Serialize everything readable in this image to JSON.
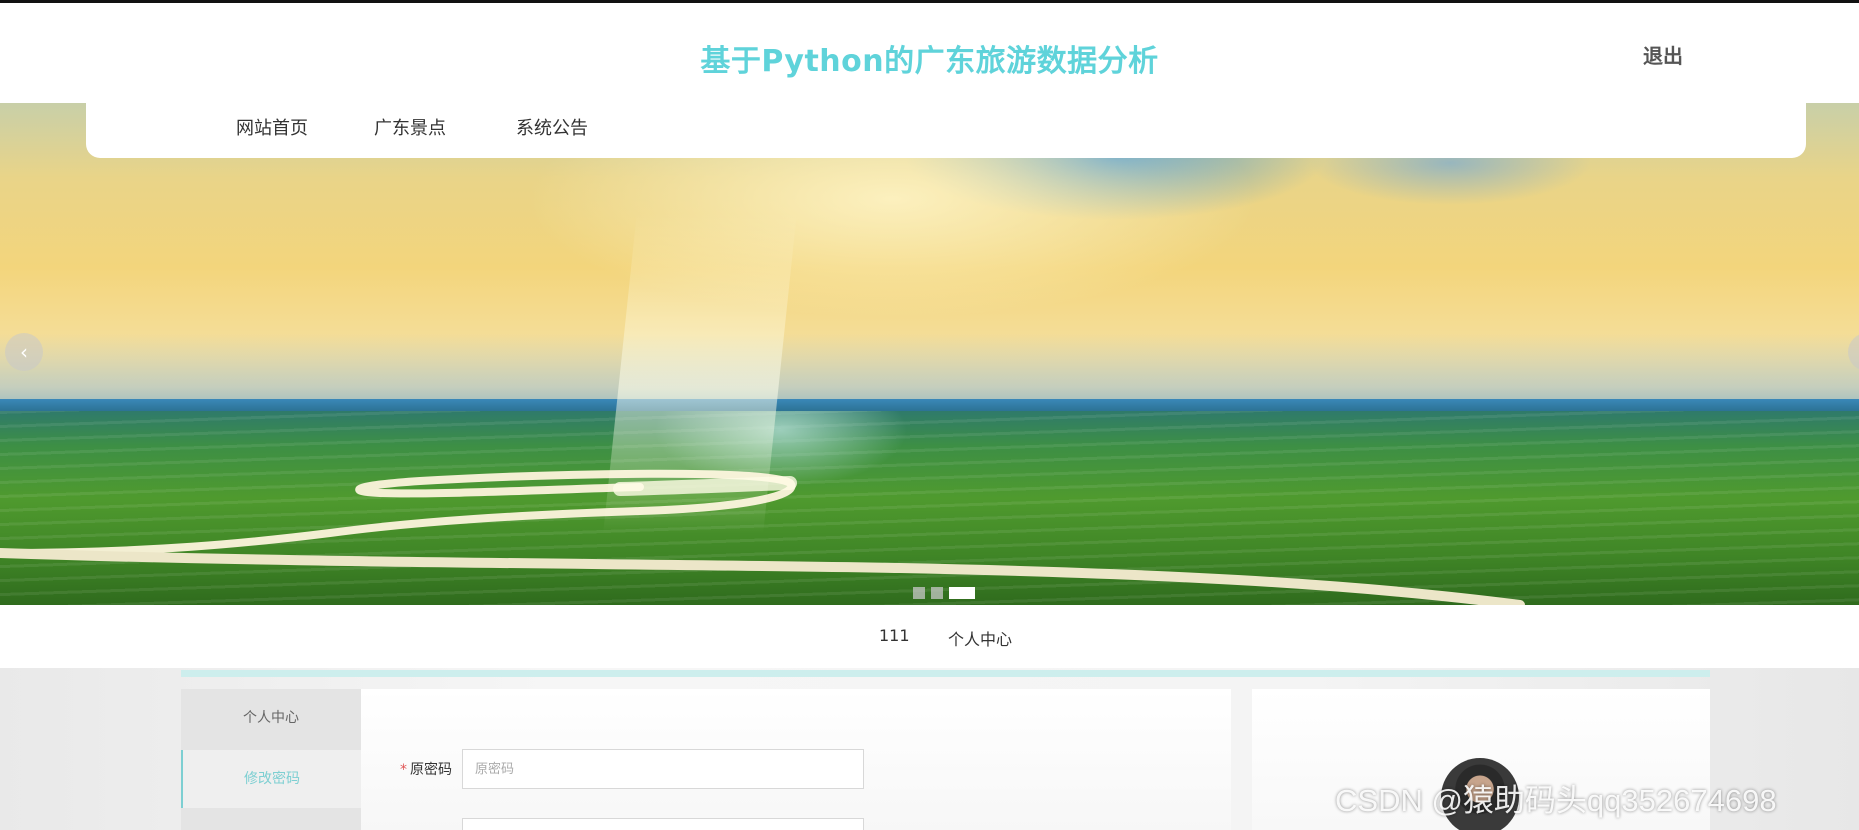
{
  "header": {
    "title": "基于Python的广东旅游数据分析",
    "logout_label": "退出"
  },
  "nav": {
    "items": [
      {
        "label": "网站首页"
      },
      {
        "label": "广东景点"
      },
      {
        "label": "系统公告"
      }
    ]
  },
  "carousel": {
    "prev_icon": "chevron-left-icon",
    "next_icon": "chevron-right-icon",
    "prev_glyph": "‹",
    "next_glyph": "›",
    "slide_count": 3,
    "active_index": 2
  },
  "breadcrumb": {
    "current_user": "111",
    "section": "个人中心"
  },
  "sidebar": {
    "items": [
      {
        "label": "个人中心"
      },
      {
        "label": "修改密码"
      }
    ]
  },
  "form": {
    "old_password_label": "原密码",
    "old_password_placeholder": "原密码",
    "old_password_value": ""
  },
  "watermark": "CSDN @猿助码头qq352674698",
  "colors": {
    "title": "#5fd3da",
    "accent": "#7dcfd2",
    "required": "#e05555"
  }
}
